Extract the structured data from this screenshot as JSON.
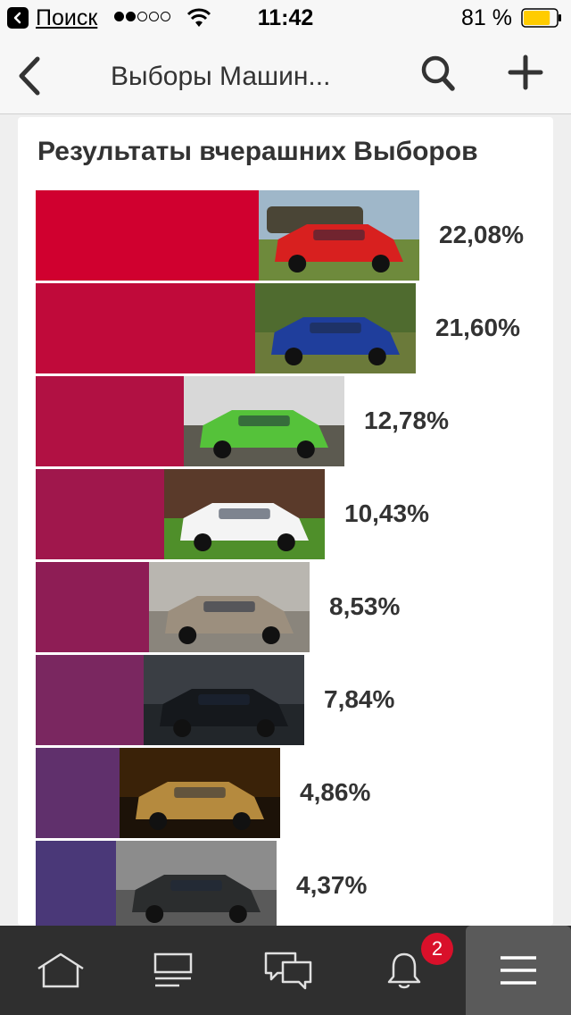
{
  "status_bar": {
    "back_app": "Поиск",
    "signal_dots": [
      true,
      true,
      false,
      false,
      false
    ],
    "time": "11:42",
    "battery_percent": "81 %",
    "battery_level": 0.81,
    "battery_color": "#ffcc00"
  },
  "nav": {
    "title": "Выборы Машин..."
  },
  "card": {
    "title": "Результаты вчерашних Выборов",
    "results": [
      {
        "label": "22,08%",
        "value": 22.08,
        "color": "#d0002f",
        "photo": "red-sedan-and-suv-photo"
      },
      {
        "label": "21,60%",
        "value": 21.6,
        "color": "#c00a3a",
        "photo": "blue-subaru-photo"
      },
      {
        "label": "12,78%",
        "value": 12.78,
        "color": "#b11143",
        "photo": "green-suv-photo"
      },
      {
        "label": "10,43%",
        "value": 10.43,
        "color": "#a0174c",
        "photo": "white-hatchback-photo"
      },
      {
        "label": "8,53%",
        "value": 8.53,
        "color": "#8e1d55",
        "photo": "beige-skoda-photo"
      },
      {
        "label": "7,84%",
        "value": 7.84,
        "color": "#7a2760",
        "photo": "black-mazda-photo"
      },
      {
        "label": "4,86%",
        "value": 4.86,
        "color": "#60306c",
        "photo": "gold-mercedes-photo"
      },
      {
        "label": "4,37%",
        "value": 4.37,
        "color": "#4a3878",
        "photo": "black-duster-photo"
      }
    ]
  },
  "tab_bar": {
    "tabs": [
      "home-icon",
      "feed-icon",
      "messages-icon",
      "bell-icon",
      "menu-icon"
    ],
    "notification_count": "2",
    "active_tab": "menu-icon"
  }
}
